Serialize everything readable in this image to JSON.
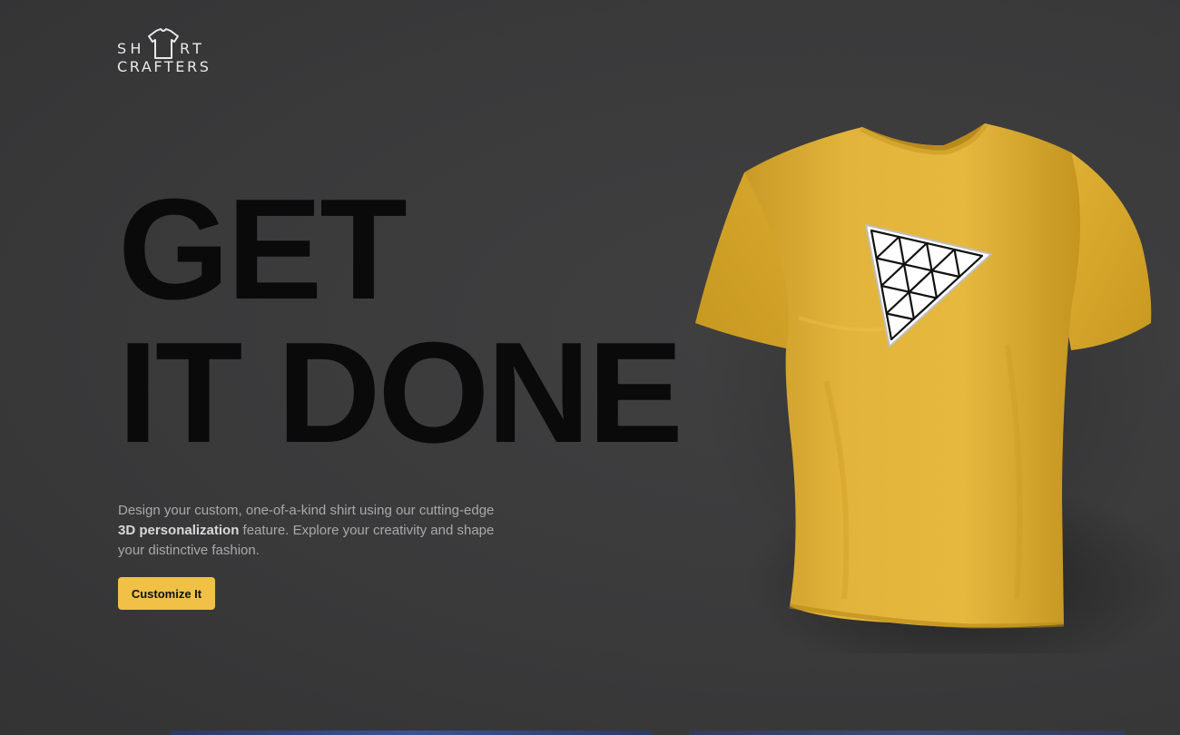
{
  "brand": {
    "logo_row1_left": "SH",
    "logo_row1_right": "RT",
    "logo_row2": "CRAFTERS",
    "logo_icon": "tshirt-icon"
  },
  "hero": {
    "headline_line1": "GET",
    "headline_line2": "IT DONE",
    "description_prefix": "Design your custom, one-of-a-kind shirt using our cutting-edge",
    "description_bold": "3D personalization",
    "description_suffix": "feature. Explore your creativity and shape your distinctive fashion.",
    "cta_label": "Customize It"
  },
  "preview": {
    "shirt_color": "#e2b236",
    "decal_icon": "triangle-grid-logo-icon"
  },
  "colors": {
    "background": "#3a3a3b",
    "accent": "#f0c146",
    "headline": "#0a0a0a"
  }
}
